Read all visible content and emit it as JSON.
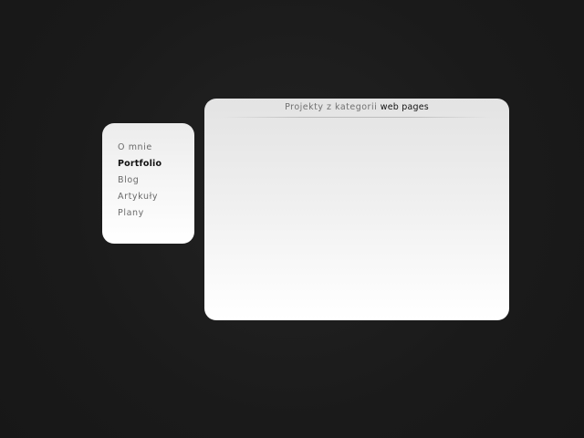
{
  "nav": {
    "items": [
      {
        "label": "O mnie"
      },
      {
        "label": "Portfolio"
      },
      {
        "label": "Blog"
      },
      {
        "label": "Artykuły"
      },
      {
        "label": "Plany"
      }
    ],
    "active": "Portfolio"
  },
  "content": {
    "header_prefix": "Projekty z kategorii",
    "header_category": "web pages"
  },
  "colors": {
    "background": "#1b1b1b",
    "card": "#f2f2f2",
    "active_text": "#111111",
    "muted_text": "#6a6a6a"
  }
}
